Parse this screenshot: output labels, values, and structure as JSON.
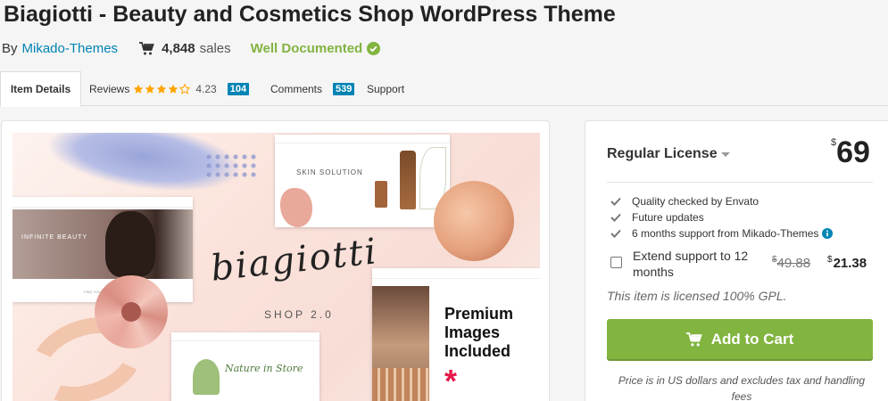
{
  "header": {
    "title": "Biagiotti - Beauty and Cosmetics Shop WordPress Theme",
    "by_label": "By",
    "author": "Mikado-Themes",
    "sales_count": "4,848",
    "sales_label": "sales",
    "documented_label": "Well Documented"
  },
  "tabs": {
    "item_details": "Item Details",
    "reviews": "Reviews",
    "rating": "4.23",
    "reviews_count": "104",
    "comments": "Comments",
    "comments_count": "539",
    "support": "Support"
  },
  "preview": {
    "logo_text": "biagiotti",
    "shop_version": "SHOP 2.0",
    "premium_lines": [
      "Premium",
      "Images",
      "Included"
    ],
    "asterisk": "*",
    "mock_top_text": "SKIN SOLUTION",
    "mock_left_text": "INFINITE BEAUTY",
    "mock_left_footer": "FIND YOUR BEAUTY ROUTINE",
    "mock_bottom_text": "Nature in Store"
  },
  "license": {
    "name": "Regular License",
    "currency": "$",
    "price": "69",
    "features": [
      "Quality checked by Envato",
      "Future updates",
      "6 months support from Mikado-Themes"
    ],
    "extend_label": "Extend support to 12 months",
    "old_price": "49.88",
    "new_price": "21.38",
    "gpl_note": "This item is licensed 100% GPL.",
    "add_to_cart": "Add to Cart",
    "price_note": "Price is in US dollars and excludes tax and handling fees"
  },
  "colors": {
    "envato_green": "#82b440",
    "link_blue": "#0084b4",
    "star_orange": "#ffa500",
    "accent_red": "#e5184a"
  },
  "icons": {
    "cart": "shopping-cart-icon",
    "documented": "check-circle-icon",
    "feature": "check-icon",
    "info": "info-icon"
  }
}
